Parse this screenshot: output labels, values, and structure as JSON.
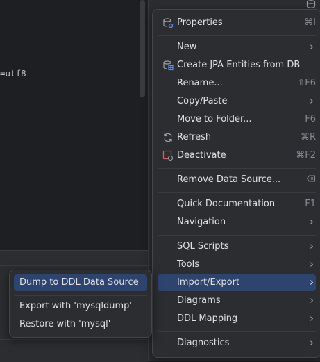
{
  "editor": {
    "code_fragment": "=utf8"
  },
  "menu": {
    "properties": {
      "label": "Properties",
      "shortcut": "⌘I"
    },
    "new": {
      "label": "New"
    },
    "create_jpa": {
      "label": "Create JPA Entities from DB"
    },
    "rename": {
      "label": "Rename...",
      "shortcut": "⇧F6"
    },
    "copy_paste": {
      "label": "Copy/Paste"
    },
    "move_to_folder": {
      "label": "Move to Folder...",
      "shortcut": "F6"
    },
    "refresh": {
      "label": "Refresh",
      "shortcut": "⌘R"
    },
    "deactivate": {
      "label": "Deactivate",
      "shortcut": "⌘F2"
    },
    "remove_data_source": {
      "label": "Remove Data Source..."
    },
    "quick_documentation": {
      "label": "Quick Documentation",
      "shortcut": "F1"
    },
    "navigation": {
      "label": "Navigation"
    },
    "sql_scripts": {
      "label": "SQL Scripts"
    },
    "tools": {
      "label": "Tools"
    },
    "import_export": {
      "label": "Import/Export"
    },
    "diagrams": {
      "label": "Diagrams"
    },
    "ddl_mapping": {
      "label": "DDL Mapping"
    },
    "diagnostics": {
      "label": "Diagnostics"
    }
  },
  "submenu": {
    "dump_ddl": {
      "label": "Dump to DDL Data Source"
    },
    "export_mysqldump": {
      "label": "Export with 'mysqldump'"
    },
    "restore_mysql": {
      "label": "Restore with 'mysql'"
    }
  },
  "colors": {
    "selection": "#2e436e",
    "menu_bg": "#2b2d30",
    "accent_blue": "#548af7",
    "deactivate_red": "#db5c5c"
  },
  "icons": {
    "properties": "database-settings-icon",
    "create_jpa": "database-table-icon",
    "refresh": "refresh-icon",
    "deactivate": "deactivate-icon",
    "remove": "backspace-icon",
    "submenu_arrow": "chevron-right-icon",
    "toolwindow": "database-icon"
  }
}
